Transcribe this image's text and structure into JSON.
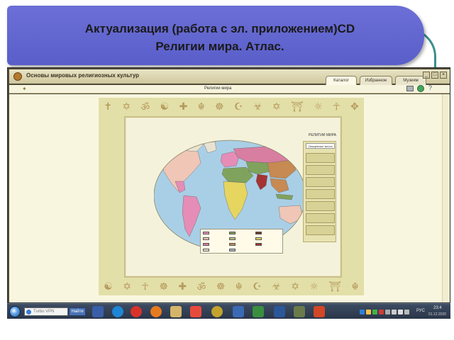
{
  "slide": {
    "title_line1": "Актуализация (работа с эл. приложением)CD",
    "title_line2": "Религии мира. Атлас."
  },
  "app": {
    "window_title": "Основы мировых религиозных культур",
    "tabs": [
      {
        "label": "Каталог",
        "active": true
      },
      {
        "label": "Избранное",
        "active": false
      },
      {
        "label": "Музеям",
        "active": false
      }
    ],
    "content_label": "Религии мира",
    "map": {
      "title": "РЕЛИГИИ МИРА",
      "nav_header": "Священные места",
      "colors": {
        "ocean": "#a9cfe6",
        "land_default": "#b9c27a",
        "christian_catholic": "#e58db6",
        "protestant": "#f0c6b6",
        "orthodox": "#d77ea1",
        "islam": "#7fa35c",
        "buddhism": "#c68a52",
        "hinduism": "#a43434",
        "traditional": "#e6d55f"
      }
    }
  },
  "symbols": {
    "top": [
      "✝",
      "✡",
      "ॐ",
      "☯",
      "✚",
      "☬",
      "☸",
      "☪",
      "☣",
      "✡",
      "⛩",
      "☼",
      "☥",
      "✥"
    ],
    "bottom": [
      "☯",
      "✡",
      "☥",
      "☸",
      "✚",
      "ॐ",
      "☸",
      "☬",
      "☪",
      "☣",
      "✡",
      "☼",
      "⛩",
      "☬"
    ]
  },
  "taskbar": {
    "search_text": "Turbo VPN",
    "find_label": "Найти",
    "lang": "РУС",
    "time": "23:4",
    "date": "01.12.2020"
  }
}
